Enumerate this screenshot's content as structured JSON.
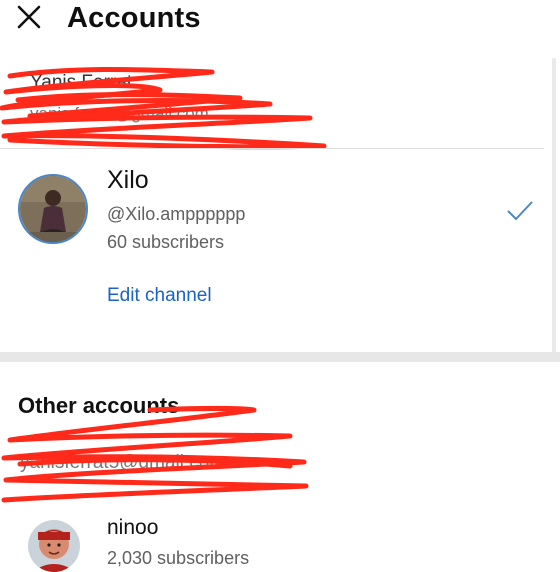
{
  "header": {
    "title": "Accounts",
    "close_icon": "close-icon"
  },
  "google_account": {
    "name": "Yanis Ferrat",
    "email": "yanis.ferrat@gmail.com"
  },
  "current_channel": {
    "name": "Xilo",
    "handle": "@Xilo.ampppppp",
    "subscribers": "60 subscribers",
    "edit_label": "Edit channel",
    "selected_icon": "checkmark-icon"
  },
  "other_accounts": {
    "heading": "Other accounts",
    "email": "yanisferrat5@gmail.com",
    "channels": [
      {
        "name": "ninoo",
        "subscribers": "2,030 subscribers"
      }
    ]
  },
  "colors": {
    "accent_link": "#1a63c5",
    "check": "#4a86c5",
    "redaction": "#ff2a1a"
  }
}
